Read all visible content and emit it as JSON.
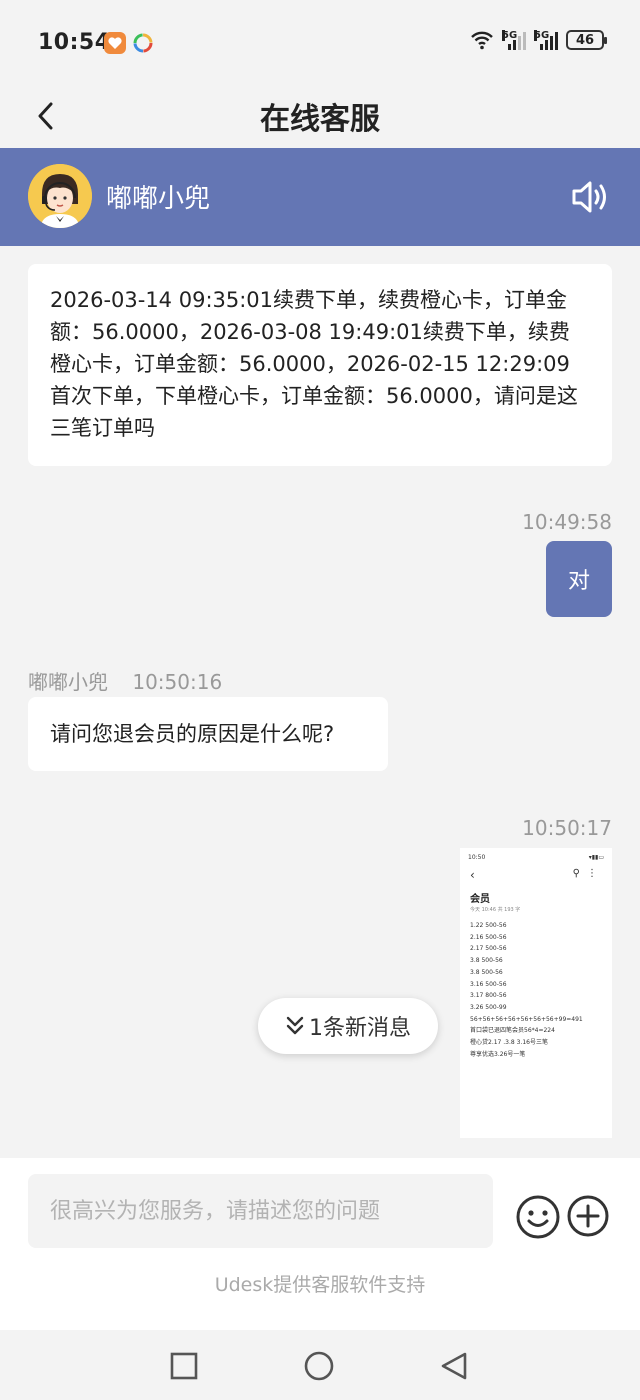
{
  "status_bar": {
    "time": "10:54",
    "network1": "5G",
    "network2": "5G",
    "battery": "46"
  },
  "title_bar": {
    "title": "在线客服"
  },
  "agent": {
    "name": "嘟嘟小兜"
  },
  "messages": {
    "m1_text": "2026-03-14 09:35:01续费下单，续费橙心卡，订单金额：56.0000，2026-03-08 19:49:01续费下单，续费橙心卡，订单金额：56.0000，2026-02-15 12:29:09首次下单，下单橙心卡，订单金额：56.0000，请问是这三笔订单吗",
    "m2_time": "10:49:58",
    "m2_text": "对",
    "m3_sender": "嘟嘟小兜",
    "m3_time": "10:50:16",
    "m3_text": "请问您退会员的原因是什么呢?",
    "m4_time": "10:50:17"
  },
  "screenshot_thumb": {
    "time": "10:50",
    "title": "会员",
    "subtitle": "今天 10:46 共 193 字",
    "lines": [
      "1.22  500-56",
      "2.16  500-56",
      "2.17  500-56",
      "3.8   500-56",
      "3.8   500-56",
      "3.16  500-56",
      "3.17  800-56",
      "3.26  500-99",
      "56+56+56+56+56+56+56+99=491",
      "首口袋已退四笔会员56*4=224",
      "橙心贷2.17 .3.8  3.16号三笔",
      "尊享优选3.26号一笔"
    ]
  },
  "new_message": {
    "label": "1条新消息"
  },
  "input": {
    "placeholder": "很高兴为您服务，请描述您的问题"
  },
  "footer": {
    "powered_by": "Udesk提供客服软件支持"
  }
}
